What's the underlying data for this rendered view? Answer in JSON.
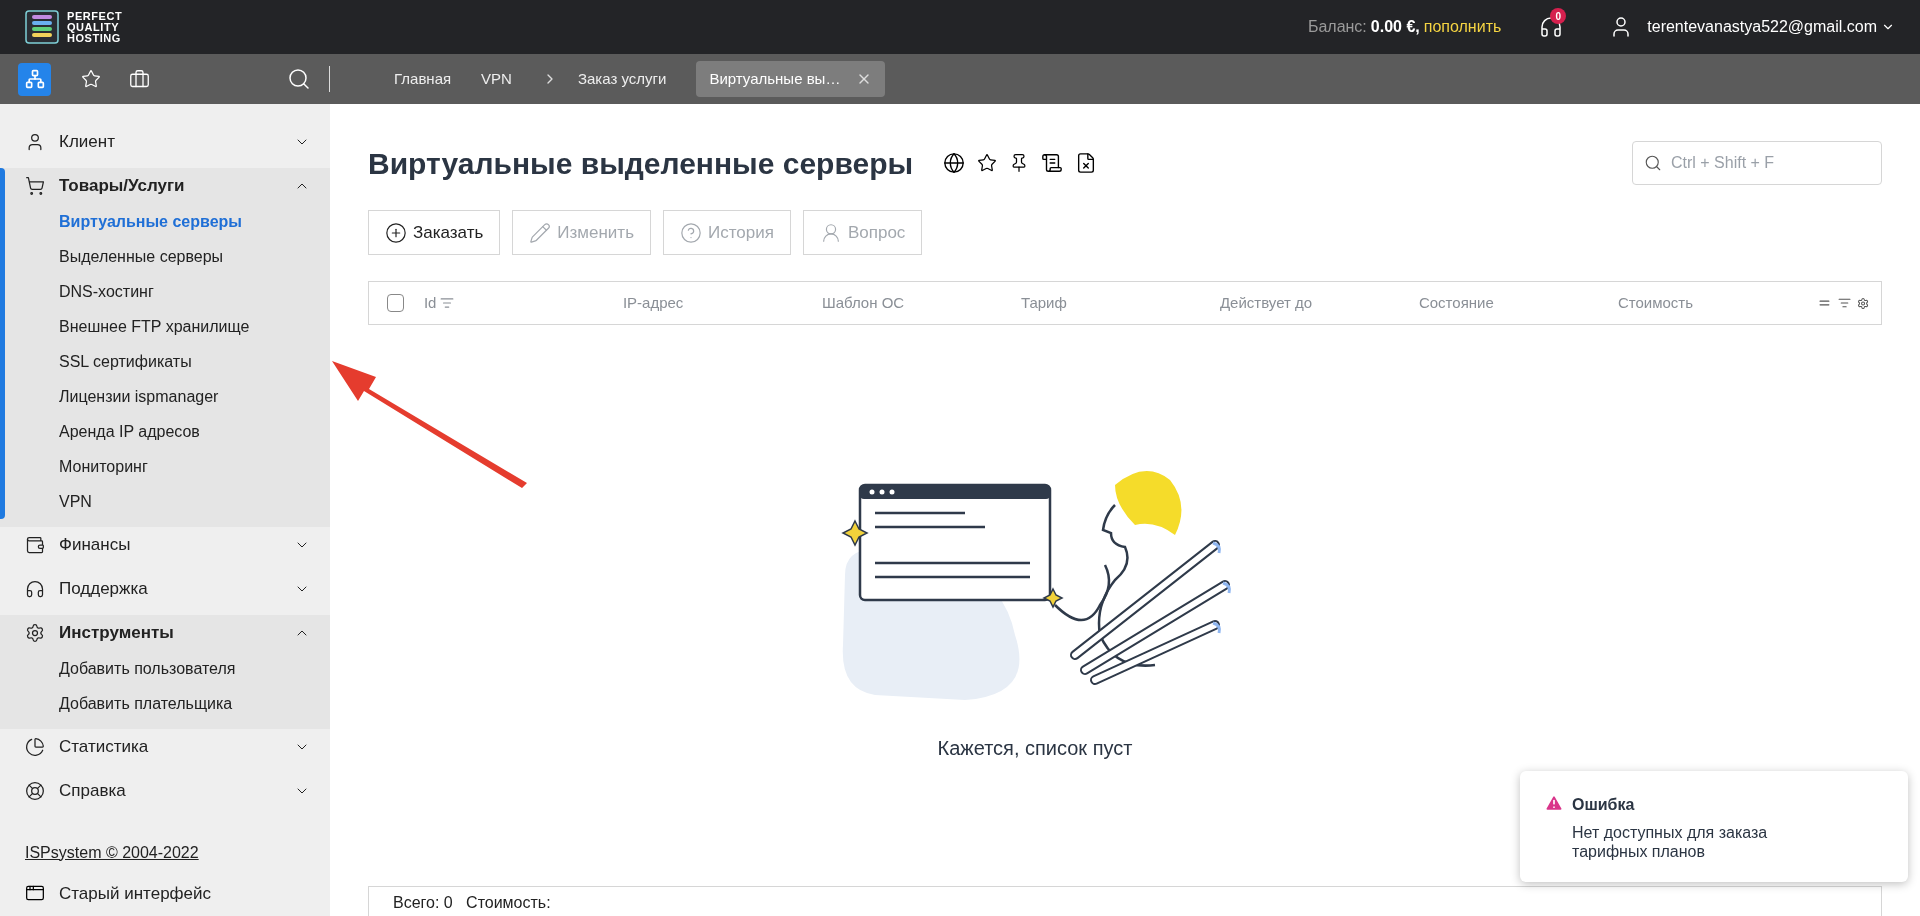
{
  "header": {
    "logo_text": [
      "PERFECT",
      "QUALITY",
      "HOSTING"
    ],
    "balance_label": "Баланс:",
    "balance_value": "0.00 €,",
    "topup_link": "пополнить",
    "support_badge": "0",
    "user_email": "terentevanastya522@gmail.com"
  },
  "toolbar": {
    "breadcrumbs": [
      {
        "label": "Главная",
        "kind": "link"
      },
      {
        "label": "VPN",
        "kind": "link"
      },
      {
        "label": "Заказ услуги",
        "kind": "chevron"
      }
    ],
    "tab": {
      "label": "Виртуальные вы…",
      "selected": true
    }
  },
  "sidebar": {
    "groups": [
      {
        "label": "Клиент",
        "expanded": false
      },
      {
        "label": "Товары/Услуги",
        "expanded": true,
        "children": [
          {
            "label": "Виртуальные серверы",
            "selected": true
          },
          {
            "label": "Выделенные серверы",
            "selected": false
          },
          {
            "label": "DNS-хостинг",
            "selected": false
          },
          {
            "label": "Внешнее FTP хранилище",
            "selected": false
          },
          {
            "label": "SSL сертификаты",
            "selected": false
          },
          {
            "label": "Лицензии ispmanager",
            "selected": false
          },
          {
            "label": "Аренда IP адресов",
            "selected": false
          },
          {
            "label": "Мониторинг",
            "selected": false
          },
          {
            "label": "VPN",
            "selected": false
          }
        ]
      },
      {
        "label": "Финансы",
        "expanded": false
      },
      {
        "label": "Поддержка",
        "expanded": false
      },
      {
        "label": "Инструменты",
        "expanded": true,
        "children": [
          {
            "label": "Добавить пользователя",
            "selected": false
          },
          {
            "label": "Добавить плательщика",
            "selected": false
          }
        ]
      },
      {
        "label": "Статистика",
        "expanded": false
      },
      {
        "label": "Справка",
        "expanded": false
      }
    ],
    "copyright": "ISPsystem © 2004-2022",
    "old_interface": "Старый интерфейс"
  },
  "page": {
    "title": "Виртуальные выделенные серверы",
    "search": {
      "placeholder": "Ctrl + Shift + F"
    },
    "actions": [
      {
        "label": "Заказать",
        "disabled": false
      },
      {
        "label": "Изменить",
        "disabled": true
      },
      {
        "label": "История",
        "disabled": true
      },
      {
        "label": "Вопрос",
        "disabled": true
      }
    ],
    "table": {
      "select_all": {
        "checked": false
      },
      "columns": [
        "Id",
        "IP-адрес",
        "Шаблон ОС",
        "Тариф",
        "Действует до",
        "Состояние",
        "Стоимость"
      ]
    },
    "empty_text": "Кажется, список пуст",
    "footer": "Всего: 0   Стоимость:"
  },
  "toast": {
    "title": "Ошибка",
    "message": "Нет доступных для заказа тарифных планов"
  }
}
